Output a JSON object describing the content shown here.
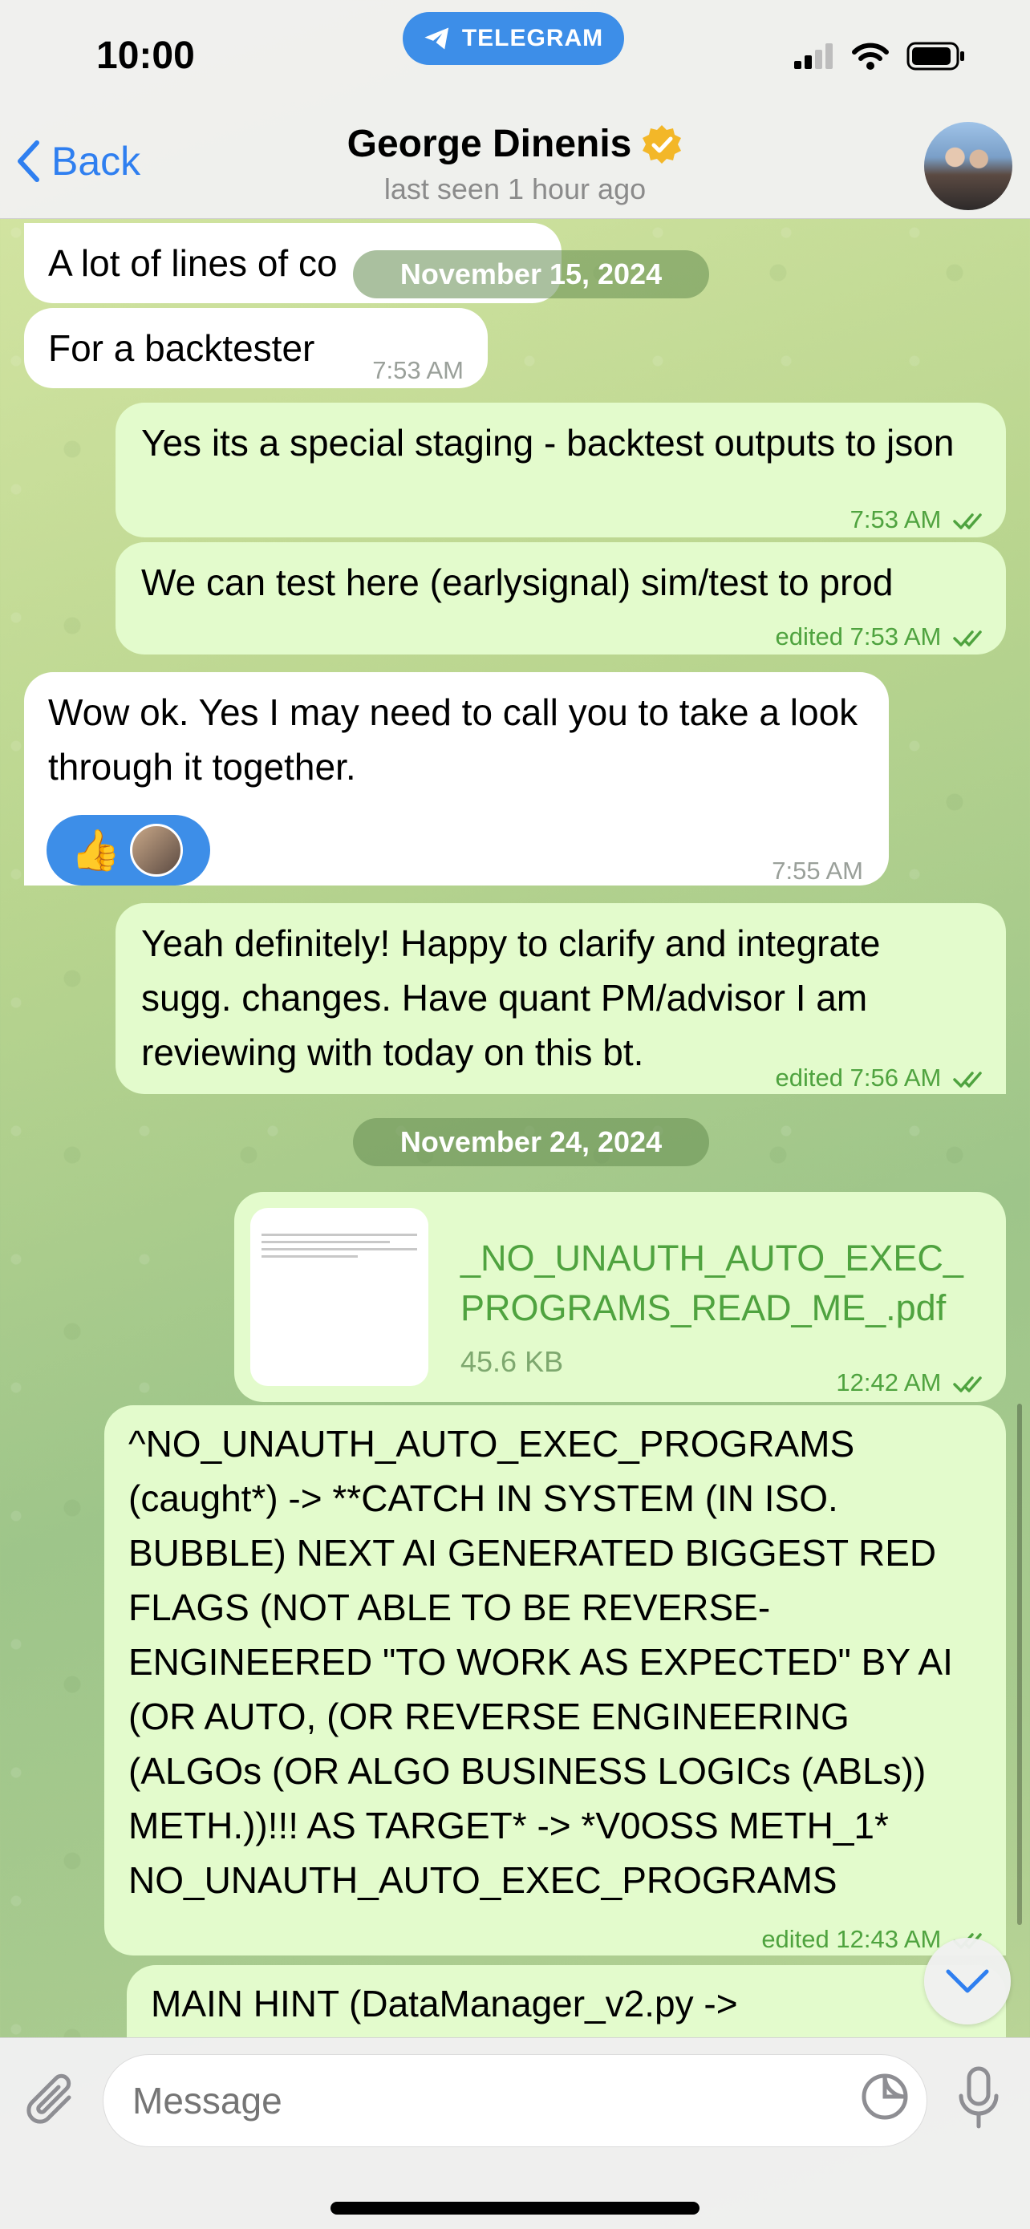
{
  "status_bar": {
    "time": "10:00",
    "pill_label": "TELEGRAM"
  },
  "header": {
    "back_label": "Back",
    "contact_name": "George Dinenis",
    "contact_status": "last seen 1 hour ago"
  },
  "date_separators": [
    "November 15, 2024",
    "November 24, 2024"
  ],
  "messages": [
    {
      "side": "in",
      "text": "A lot of lines of co"
    },
    {
      "side": "in",
      "text": "For a backtester",
      "time": "7:53 AM"
    },
    {
      "side": "out",
      "text": "Yes its a special staging - backtest outputs to json",
      "time": "7:53 AM"
    },
    {
      "side": "out",
      "text": "We can test here (earlysignal) sim/test to prod",
      "time": "edited 7:53 AM"
    },
    {
      "side": "in",
      "text": "Wow ok. Yes I may need to call you to take a look through it together.",
      "time": "7:55 AM",
      "reaction": "👍"
    },
    {
      "side": "out",
      "text": "Yeah definitely! Happy to clarify and integrate sugg. changes. Have quant PM/advisor I am reviewing with today on this bt.",
      "time": "edited 7:56 AM"
    },
    {
      "side": "out",
      "file_name": "_NO_UNAUTH_AUTO_EXEC_PROGRAMS_READ_ME_.pdf",
      "file_name_line1": "_NO_UNAUTH_AUTO_EXEC_",
      "file_name_line2": "PROGRAMS_READ_ME_.pdf",
      "file_size": "45.6 KB",
      "time": "12:42 AM"
    },
    {
      "side": "out",
      "text": "^NO_UNAUTH_AUTO_EXEC_PROGRAMS (caught*)  -> **CATCH IN SYSTEM (IN ISO. BUBBLE) NEXT AI GENERATED BIGGEST RED FLAGS (NOT ABLE TO BE REVERSE-ENGINEERED \"TO WORK AS EXPECTED\" BY AI (OR AUTO, (OR REVERSE ENGINEERING (ALGOs (OR ALGO BUSINESS LOGICs (ABLs)) METH.))!!! AS TARGET* -> *V0OSS METH_1* NO_UNAUTH_AUTO_EXEC_PROGRAMS",
      "time": "edited 12:43 AM"
    },
    {
      "side": "out",
      "text": "MAIN HINT (DataManager_v2.py ->"
    }
  ],
  "input": {
    "placeholder": "Message"
  },
  "colors": {
    "accent": "#2f7ff0",
    "outgoing_bubble": "#e3fbcc",
    "incoming_bubble": "#ffffff",
    "check_green": "#4fa33f"
  },
  "icons": [
    "telegram-plane-icon",
    "signal-icon",
    "wifi-icon",
    "battery-icon",
    "back-chevron-icon",
    "verified-badge-icon",
    "double-check-icon",
    "thumbs-up-icon",
    "chevron-down-icon",
    "paperclip-icon",
    "sticker-icon",
    "microphone-icon"
  ]
}
